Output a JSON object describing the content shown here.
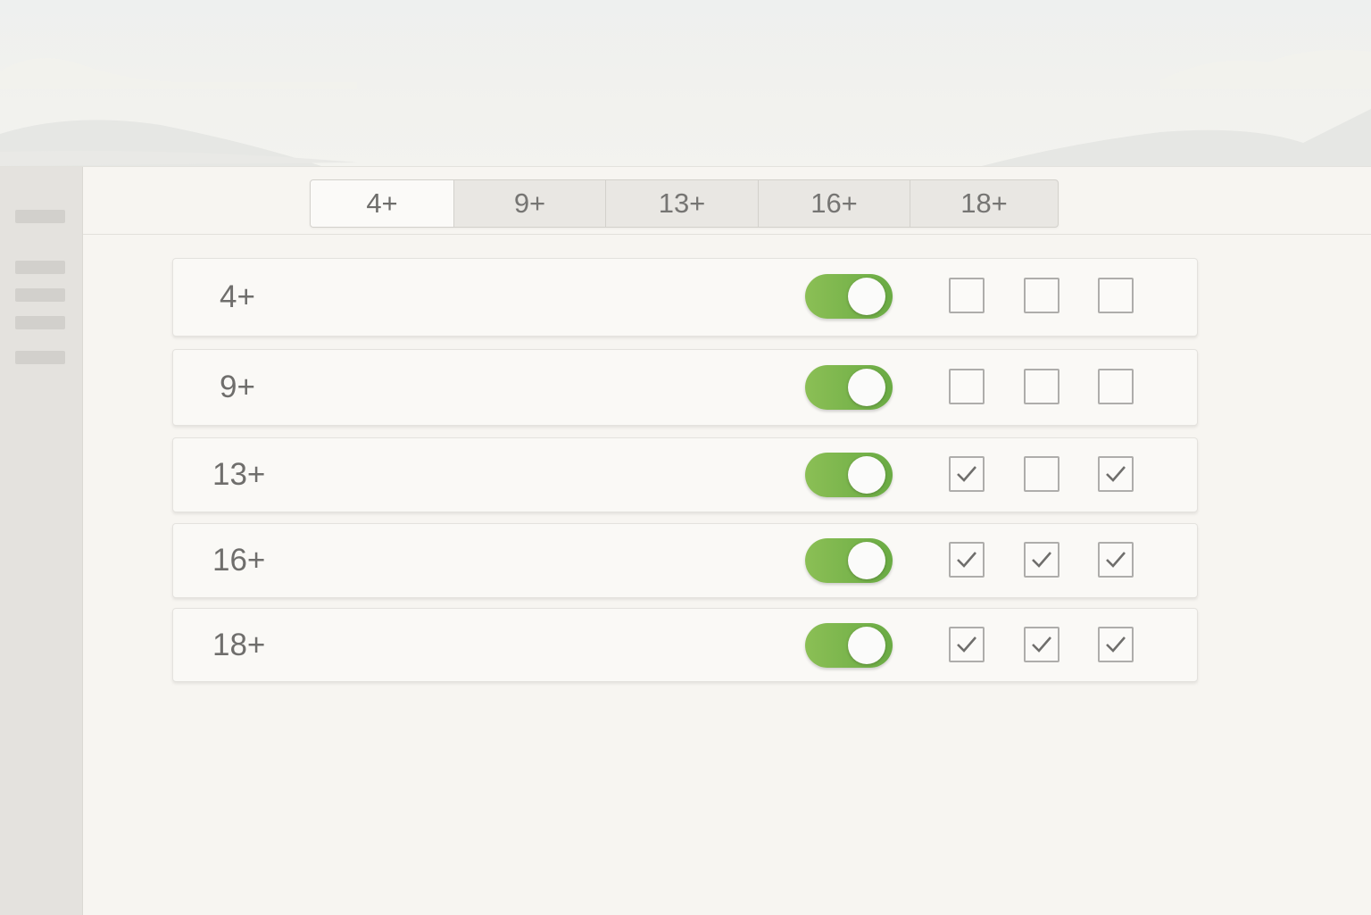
{
  "tabs": [
    {
      "label": "4+",
      "active": true
    },
    {
      "label": "9+",
      "active": false
    },
    {
      "label": "13+",
      "active": false
    },
    {
      "label": "16+",
      "active": false
    },
    {
      "label": "18+",
      "active": false
    }
  ],
  "rows": [
    {
      "label": "4+",
      "toggle_on": true,
      "checks": [
        false,
        false,
        false
      ]
    },
    {
      "label": "9+",
      "toggle_on": true,
      "checks": [
        false,
        false,
        false
      ]
    },
    {
      "label": "13+",
      "toggle_on": true,
      "checks": [
        true,
        false,
        true
      ]
    },
    {
      "label": "16+",
      "toggle_on": true,
      "checks": [
        true,
        true,
        true
      ]
    },
    {
      "label": "18+",
      "toggle_on": true,
      "checks": [
        true,
        true,
        true
      ]
    }
  ],
  "colors": {
    "toggle_on": "#6aab44",
    "background": "#f7f5f1",
    "sidebar": "#e4e2de"
  }
}
